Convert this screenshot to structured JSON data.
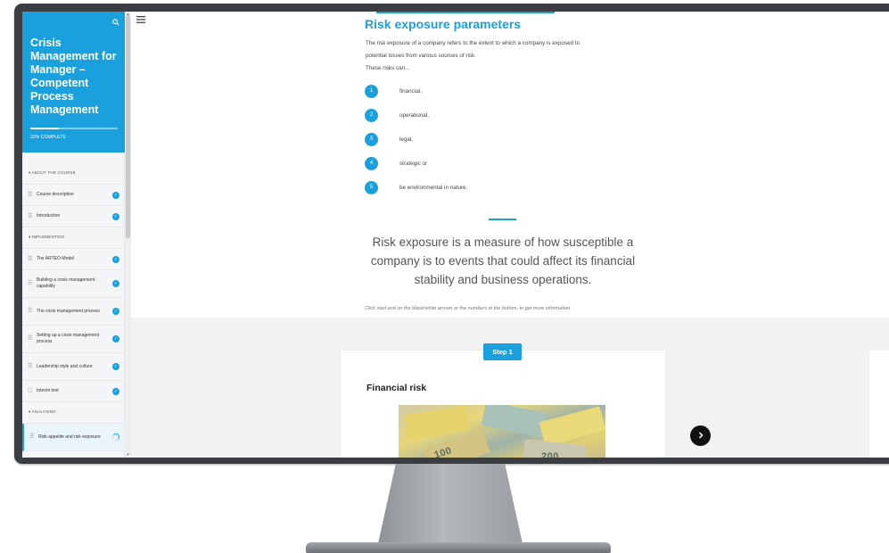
{
  "sidebar": {
    "course_title": "Crisis Management for Manager – Competent Process Management",
    "progress_label": "33% COMPLETE",
    "progress_fraction": 0.33,
    "sections": [
      {
        "label": "▾ ABOUT THE COURSE",
        "items": [
          {
            "label": "Course description",
            "status": "done"
          },
          {
            "label": "Introduction",
            "status": "done"
          }
        ]
      },
      {
        "label": "▾ IMPLEMENTING",
        "items": [
          {
            "label": "The ARTEO-Model",
            "status": "done"
          },
          {
            "label": "Building a crisis management capability",
            "status": "done"
          },
          {
            "label": "The crisis management process",
            "status": "done"
          },
          {
            "label": "Setting up a crisis management process",
            "status": "done"
          },
          {
            "label": "Leadership style and culture",
            "status": "done"
          },
          {
            "label": "Interim test",
            "status": "done"
          }
        ]
      },
      {
        "label": "▾ ANALYSING",
        "items": [
          {
            "label": "Risk appetite and risk exposure",
            "status": "partial"
          },
          {
            "label": "Risk analysis",
            "status": "empty"
          }
        ]
      }
    ]
  },
  "lesson": {
    "title": "Risk exposure parameters",
    "intro_lines": [
      "The risk exposure of a company refers to the extent to which a company is exposed to",
      "potential losses from various sources of risk.",
      "These risks can..."
    ],
    "risk_list": [
      {
        "number": "1",
        "text": "financial,"
      },
      {
        "number": "2",
        "text": "operational,"
      },
      {
        "number": "3",
        "text": "legal,"
      },
      {
        "number": "4",
        "text": "strategic or"
      },
      {
        "number": "5",
        "text": "be environmental in nature."
      }
    ],
    "statement": "Risk exposure is a measure of how susceptible a company is to events that could affect its financial stability and business operations.",
    "hint": "Click start and on the black/white arrows or the numbers at the bottom, to get more information."
  },
  "process": {
    "step_label": "Step 1",
    "card_title": "Financial risk",
    "image_alt_text": [
      "100",
      "200"
    ]
  },
  "icons": {
    "menu": "menu-icon",
    "search": "search-icon",
    "next": "chevron-right-icon"
  },
  "colors": {
    "accent": "#1aa0dd",
    "sidebar_bg": "#f4f5f6",
    "step_area_bg": "#f1f2f3",
    "next_button": "#111111"
  }
}
